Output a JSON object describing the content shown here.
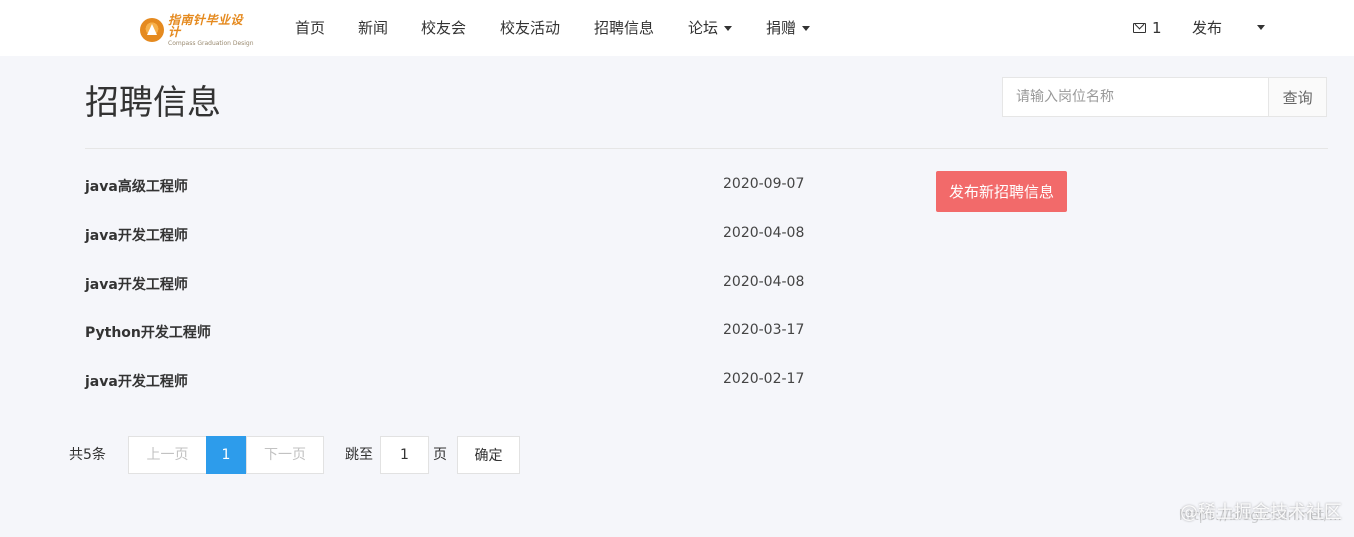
{
  "nav": {
    "logo_title": "指南针毕业设计",
    "logo_subtitle": "Compass Graduation Design",
    "items": [
      {
        "label": "首页"
      },
      {
        "label": "新闻"
      },
      {
        "label": "校友会"
      },
      {
        "label": "校友活动"
      },
      {
        "label": "招聘信息"
      },
      {
        "label": "论坛",
        "dropdown": true
      },
      {
        "label": "捐赠",
        "dropdown": true
      }
    ],
    "mail_count": "1",
    "publish_label": "发布"
  },
  "page": {
    "title": "招聘信息",
    "search": {
      "placeholder": "请输入岗位名称",
      "value": "",
      "button_label": "查询"
    },
    "post_button_label": "发布新招聘信息"
  },
  "jobs": [
    {
      "title": "java高级工程师",
      "date": "2020-09-07"
    },
    {
      "title": "java开发工程师",
      "date": "2020-04-08"
    },
    {
      "title": "java开发工程师",
      "date": "2020-04-08"
    },
    {
      "title": "Python开发工程师",
      "date": "2020-03-17"
    },
    {
      "title": "java开发工程师",
      "date": "2020-02-17"
    }
  ],
  "pagination": {
    "total_text": "共5条",
    "prev_label": "上一页",
    "current_page": "1",
    "next_label": "下一页",
    "jump_label": "跳至",
    "jump_value": "1",
    "page_unit": "页",
    "confirm_label": "确定"
  },
  "watermark": {
    "text": "@稀土掘金技术社区",
    "url": "https://blog.csdn.net/..."
  },
  "colors": {
    "accent_blue": "#2d9ceb",
    "post_button_red": "#f26a6a",
    "logo_orange": "#e58a1f",
    "page_background": "#f5f6fa"
  }
}
